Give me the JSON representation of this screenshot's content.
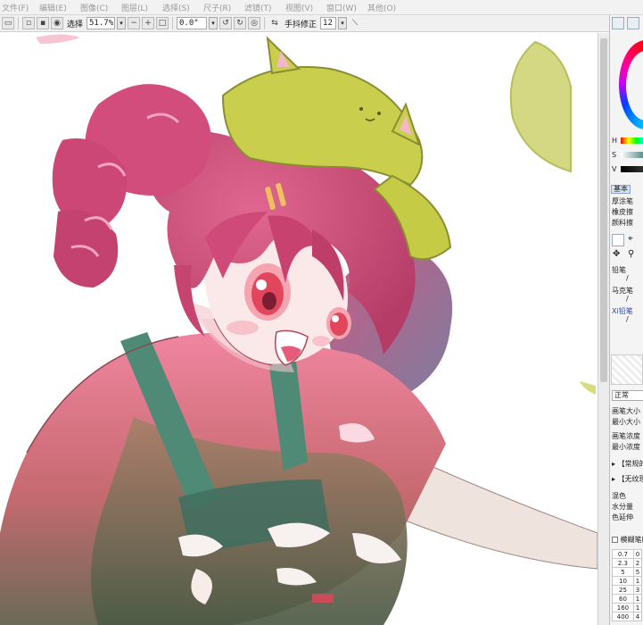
{
  "menu": [
    "文件(F)",
    "编辑(E)",
    "图像(C)",
    "图层(L)",
    "选择(S)",
    "尺子(R)",
    "滤镜(T)",
    "视图(V)",
    "窗口(W)",
    "其他(O)"
  ],
  "toolbar": {
    "select_label": "选择",
    "zoom_value": "51.7%",
    "rotate_value": "0.0°",
    "stabilizer_label": "手抖修正",
    "stabilizer_value": "12"
  },
  "panel": {
    "hsv_labels": [
      "H",
      "S",
      "V"
    ],
    "brush_tab": "基本",
    "brush_list": [
      "厚涂笔",
      "橡皮擦",
      "颜料擦"
    ],
    "tools": [
      "铅笔",
      "马克笔",
      "Xi铅笔"
    ],
    "blend_mode": "正常",
    "params": [
      "画笔大小",
      "最小大小",
      "画笔浓度",
      "最小浓度"
    ],
    "sections": [
      "【常规的",
      "【无纹理"
    ],
    "mix_params": [
      "混色",
      "水分量",
      "色延伸"
    ],
    "blur_label": "模糊笔压",
    "size_table": [
      [
        "0.7",
        "0"
      ],
      [
        "2.3",
        "2"
      ],
      [
        "5",
        "5"
      ],
      [
        "10",
        "1"
      ],
      [
        "25",
        "3"
      ],
      [
        "60",
        "1"
      ],
      [
        "160",
        "1"
      ],
      [
        "400",
        "4"
      ]
    ]
  },
  "colors": {
    "hair": "#d04f7a",
    "hat": "#c9cf4c",
    "shirt": "#ee7a94",
    "overall": "#4d8a74",
    "skin": "#fbe6e6",
    "eye": "#e2465d"
  }
}
